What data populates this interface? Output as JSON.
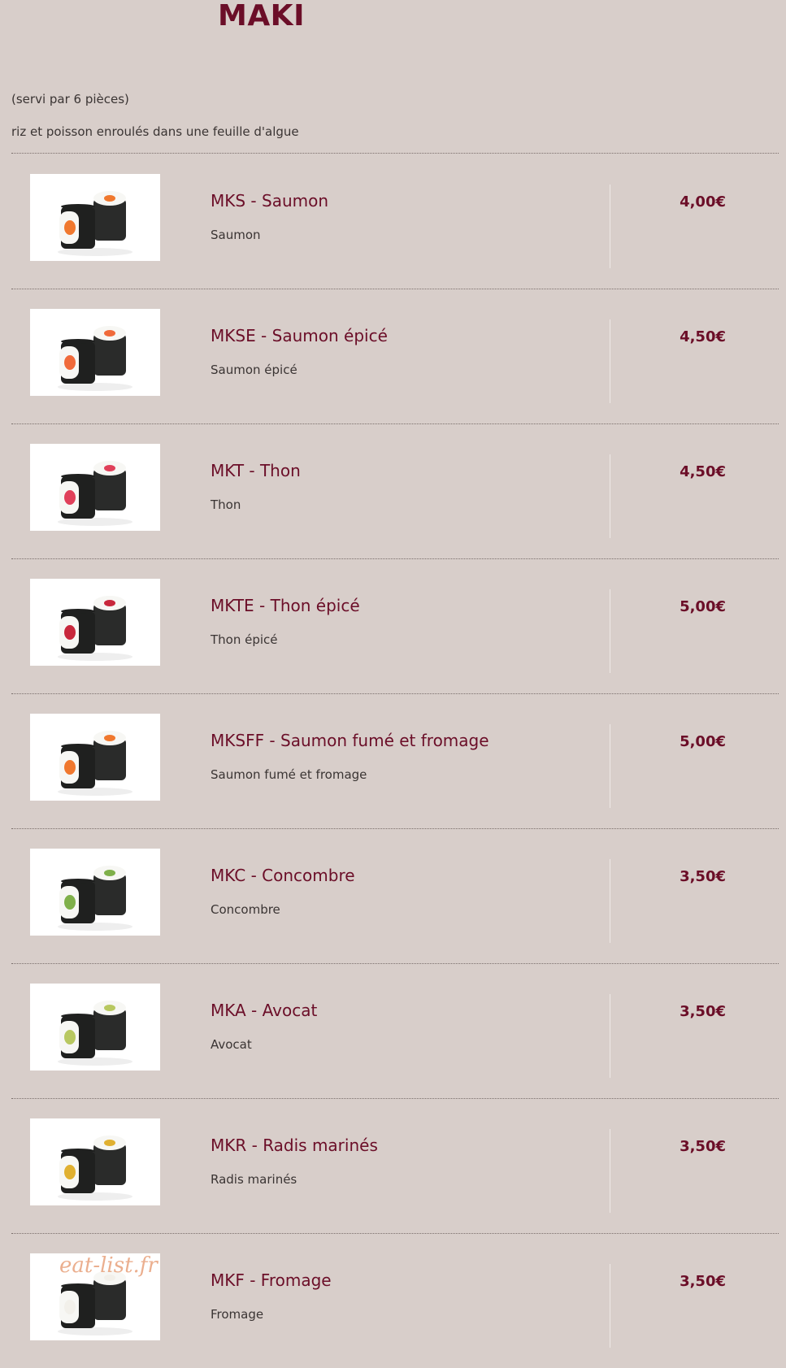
{
  "title": "MAKI",
  "intro": {
    "serving": "(servi par 6 pièces)",
    "description": "riz et poisson enroulés dans une feuille d'algue"
  },
  "watermark": "eat-list.fr",
  "items": [
    {
      "name": "MKS - Saumon",
      "description": "Saumon",
      "price": "4,00€",
      "filling": "#f0782e"
    },
    {
      "name": "MKSE - Saumon épicé",
      "description": "Saumon épicé",
      "price": "4,50€",
      "filling": "#f06a3a"
    },
    {
      "name": "MKT - Thon",
      "description": "Thon",
      "price": "4,50€",
      "filling": "#e0405a"
    },
    {
      "name": "MKTE - Thon épicé",
      "description": "Thon épicé",
      "price": "5,00€",
      "filling": "#c8283c"
    },
    {
      "name": "MKSFF - Saumon fumé et fromage",
      "description": "Saumon fumé et fromage",
      "price": "5,00€",
      "filling": "#f0782e"
    },
    {
      "name": "MKC - Concombre",
      "description": "Concombre",
      "price": "3,50€",
      "filling": "#7fb04a"
    },
    {
      "name": "MKA - Avocat",
      "description": "Avocat",
      "price": "3,50€",
      "filling": "#b8c860"
    },
    {
      "name": "MKR - Radis marinés",
      "description": "Radis marinés",
      "price": "3,50€",
      "filling": "#e0b030"
    },
    {
      "name": "MKF - Fromage",
      "description": "Fromage",
      "price": "3,50€",
      "filling": "#f2f0ea"
    }
  ]
}
